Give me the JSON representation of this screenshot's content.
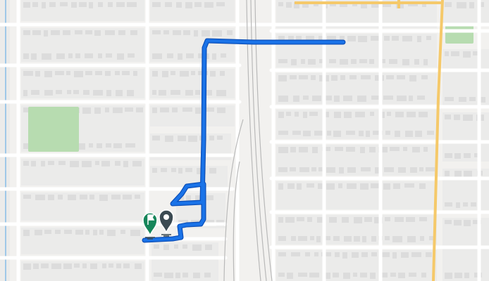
{
  "map": {
    "colors": {
      "background": "#f2f1ef",
      "block": "#ebebea",
      "building": "#dcdcdc",
      "street": "#ffffff",
      "arterial": "#f5c96a",
      "rail": "#b9b9b9",
      "park": "#b7dcb0",
      "water": "#9fc8e8",
      "route": "#1a73e8",
      "route_outline": "#0c4fb8",
      "start_marker": "#16865a",
      "end_marker": "#3b4a52"
    },
    "markers": [
      {
        "id": "start",
        "kind": "flag",
        "color": "#16865a"
      },
      {
        "id": "end",
        "kind": "pin",
        "color": "#3b4a52"
      }
    ]
  }
}
